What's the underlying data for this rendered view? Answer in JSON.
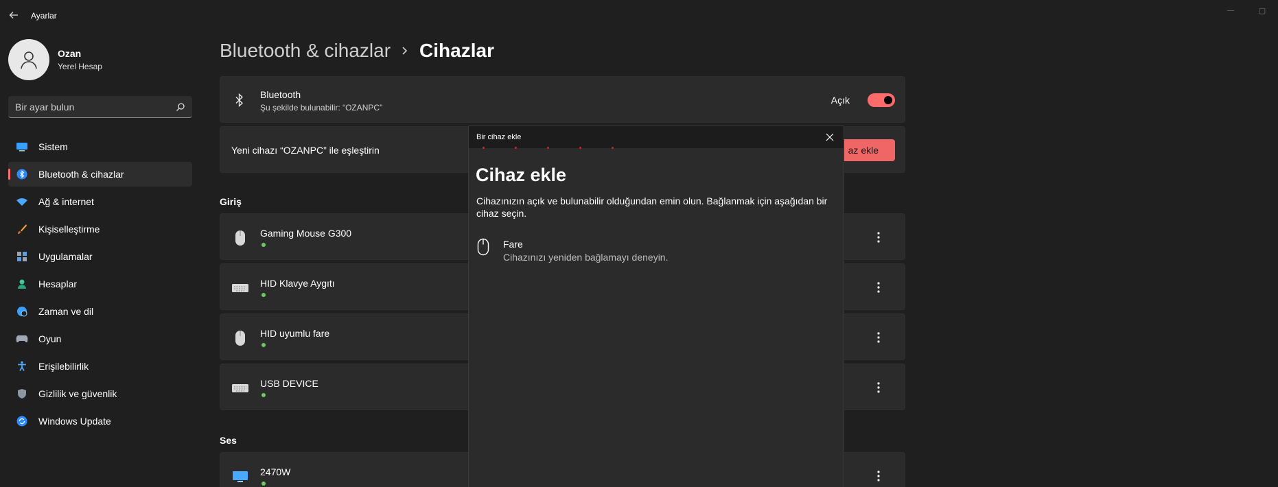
{
  "window": {
    "title": "Ayarlar",
    "minimize_glyph": "—",
    "maximize_glyph": "▢"
  },
  "profile": {
    "name": "Ozan",
    "account": "Yerel Hesap"
  },
  "search": {
    "placeholder": "Bir ayar bulun"
  },
  "sidebar": {
    "items": [
      {
        "label": "Sistem",
        "icon": "monitor-icon",
        "active": false
      },
      {
        "label": "Bluetooth & cihazlar",
        "icon": "bluetooth-icon",
        "active": true
      },
      {
        "label": "Ağ & internet",
        "icon": "wifi-icon",
        "active": false
      },
      {
        "label": "Kişiselleştirme",
        "icon": "brush-icon",
        "active": false
      },
      {
        "label": "Uygulamalar",
        "icon": "apps-icon",
        "active": false
      },
      {
        "label": "Hesaplar",
        "icon": "person-icon",
        "active": false
      },
      {
        "label": "Zaman ve dil",
        "icon": "globe-clock-icon",
        "active": false
      },
      {
        "label": "Oyun",
        "icon": "gamepad-icon",
        "active": false
      },
      {
        "label": "Erişilebilirlik",
        "icon": "accessibility-icon",
        "active": false
      },
      {
        "label": "Gizlilik ve güvenlik",
        "icon": "shield-icon",
        "active": false
      },
      {
        "label": "Windows Update",
        "icon": "update-icon",
        "active": false
      }
    ]
  },
  "breadcrumb": {
    "parent": "Bluetooth & cihazlar",
    "current": "Cihazlar"
  },
  "bluetooth_card": {
    "title": "Bluetooth",
    "subtitle": "Şu şekilde bulunabilir: “OZANPC”",
    "toggle_label": "Açık",
    "toggle_on": true
  },
  "pair_card": {
    "text": "Yeni cihazı “OZANPC” ile eşleştirin",
    "button_label": "Cihaz ekle",
    "visible_button_text": "az ekle"
  },
  "sections": {
    "input_title": "Giriş",
    "audio_title": "Ses"
  },
  "input_devices": [
    {
      "name": "Gaming Mouse G300",
      "icon": "mouse-icon",
      "connected": true
    },
    {
      "name": "HID Klavye Aygıtı",
      "icon": "keyboard-icon",
      "connected": true
    },
    {
      "name": "HID uyumlu fare",
      "icon": "mouse-icon",
      "connected": true
    },
    {
      "name": "USB DEVICE",
      "icon": "keyboard-icon",
      "connected": true
    }
  ],
  "audio_devices": [
    {
      "name": "2470W",
      "icon": "monitor-icon",
      "connected": true
    }
  ],
  "dialog": {
    "caption": "Bir cihaz ekle",
    "title": "Cihaz ekle",
    "description": "Cihazınızın açık ve bulunabilir olduğundan emin olun. Bağlanmak için aşağıdan bir cihaz seçin.",
    "device": {
      "name": "Fare",
      "status": "Cihazınızı yeniden bağlamayı deneyin.",
      "icon": "mouse-icon"
    }
  },
  "colors": {
    "accent": "#ff6a6a",
    "connected": "#6ccb5f",
    "background": "#1f1f1f",
    "card": "#2b2b2b"
  }
}
